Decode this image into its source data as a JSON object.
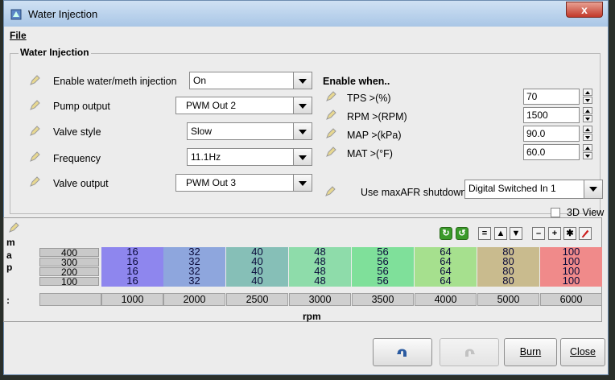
{
  "window": {
    "title": "Water Injection",
    "close_label": "x"
  },
  "menu": {
    "file_label": "File"
  },
  "group": {
    "title": "Water Injection"
  },
  "left_fields": [
    {
      "label": "Enable water/meth injection",
      "value": "On"
    },
    {
      "label": "Pump output",
      "value": "PWM Out 2"
    },
    {
      "label": "Valve style",
      "value": "Slow"
    },
    {
      "label": "Frequency",
      "value": "11.1Hz"
    },
    {
      "label": "Valve output",
      "value": "PWM Out 3"
    }
  ],
  "enable_when": {
    "heading": "Enable when..",
    "fields": [
      {
        "label": "TPS >(%)",
        "value": "70"
      },
      {
        "label": "RPM >(RPM)",
        "value": "1500"
      },
      {
        "label": "MAP >(kPa)",
        "value": "90.0"
      },
      {
        "label": "MAT >(°F)",
        "value": "60.0"
      }
    ]
  },
  "maxafr": {
    "label": "Use maxAFR shutdown",
    "value": "Digital Switched In 1"
  },
  "view3d": {
    "label": "3D View",
    "checked": false
  },
  "table": {
    "y_axis_label_chars": [
      "m",
      "a",
      "p",
      ":"
    ],
    "x_axis_label": "rpm",
    "toolbar": [
      "=",
      "▲",
      "▼",
      "–",
      "+",
      "✱"
    ],
    "row_headers": [
      "400",
      "300",
      "200",
      "100"
    ],
    "col_headers": [
      "1000",
      "2000",
      "2500",
      "3000",
      "3500",
      "4000",
      "5000",
      "6000"
    ],
    "rows": [
      [
        "16",
        "32",
        "40",
        "48",
        "56",
        "64",
        "80",
        "100"
      ],
      [
        "16",
        "32",
        "40",
        "48",
        "56",
        "64",
        "80",
        "100"
      ],
      [
        "16",
        "32",
        "40",
        "48",
        "56",
        "64",
        "80",
        "100"
      ],
      [
        "16",
        "32",
        "40",
        "48",
        "56",
        "64",
        "80",
        "100"
      ]
    ],
    "col_colors": [
      "#8e86ee",
      "#8ea6dd",
      "#86bfb7",
      "#8edcaa",
      "#7fe09a",
      "#a6e08e",
      "#c9bb8e",
      "#f08a8a"
    ]
  },
  "buttons": {
    "burn": "Burn",
    "close": "Close"
  }
}
